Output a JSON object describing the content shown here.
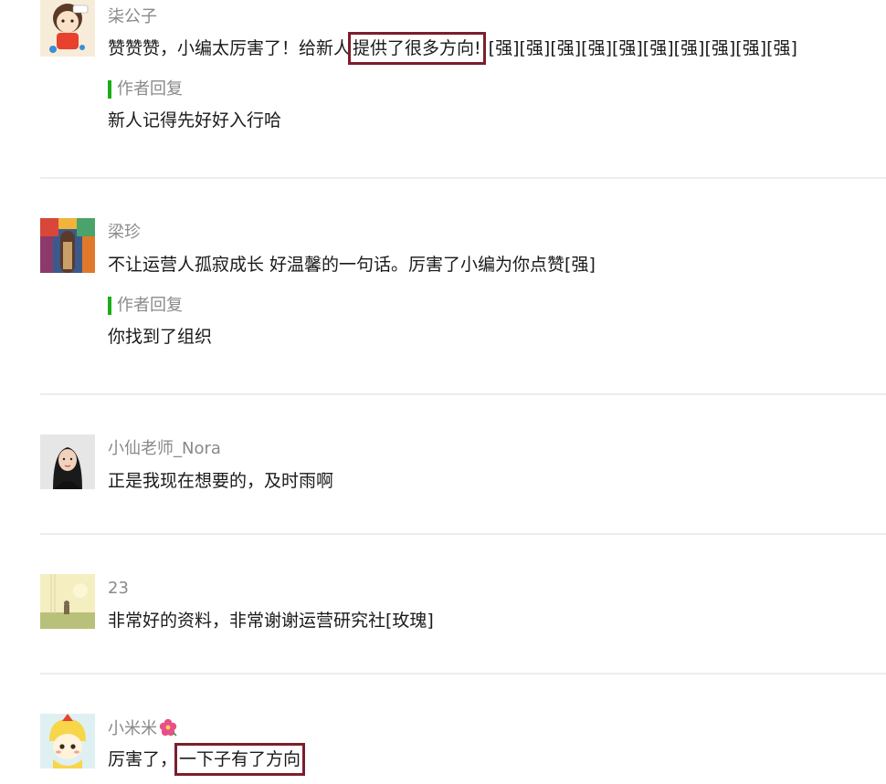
{
  "comments": [
    {
      "nickname": "柒公子",
      "content_pre": "赞赞赞，小编太厉害了！给新人",
      "content_highlight": "提供了很多方向!",
      "content_post": " [强][强][强][强][强][强][强][强][强][强]",
      "reply_label": "作者回复",
      "reply_text": "新人记得先好好入行哈"
    },
    {
      "nickname": "梁珍",
      "content": "不让运营人孤寂成长 好温馨的一句话。厉害了小编为你点赞[强]",
      "reply_label": "作者回复",
      "reply_text": "你找到了组织"
    },
    {
      "nickname": "小仙老师_Nora",
      "content": "正是我现在想要的，及时雨啊"
    },
    {
      "nickname": "23",
      "content": "非常好的资料，非常谢谢运营研究社[玫瑰]"
    },
    {
      "nickname": "小米米",
      "nickname_icon": "hibiscus-flower-icon",
      "content_pre": "厉害了，",
      "content_highlight": "一下子有了方向"
    }
  ],
  "colors": {
    "reply_bar": "#1aad19",
    "highlight_box": "#7d1e2b",
    "nickname": "#8a8a8a",
    "divider": "#ededed"
  }
}
